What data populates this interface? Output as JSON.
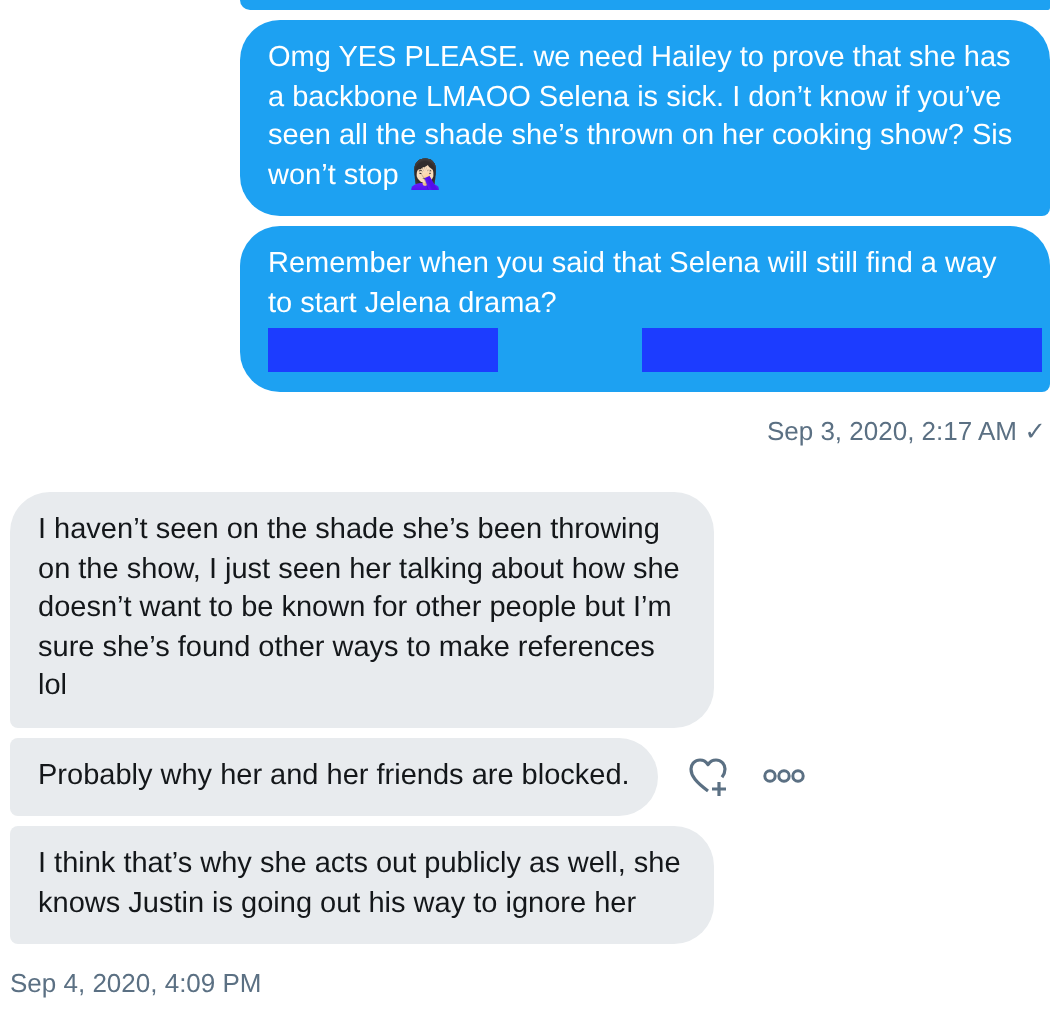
{
  "groups": [
    {
      "kind": "sent",
      "edge_above": true,
      "messages": [
        {
          "text": "Omg YES PLEASE. we need Hailey to prove that she has a backbone LMAOO Selena is sick. I don’t know if you’ve seen all the shade she’s thrown on her cooking show? Sis won’t stop 🤦🏻‍♀️",
          "redacted": false,
          "actions": false
        },
        {
          "text": "Remember when you said that Selena will still find a way to start Jelena drama?",
          "redacted": true,
          "actions": false
        }
      ],
      "timestamp": "Sep 3, 2020, 2:17 AM",
      "receipt": "✓"
    },
    {
      "kind": "received",
      "messages": [
        {
          "text": "I haven’t seen on the shade she’s been throwing on the show, I just seen her talking about how she doesn’t want to be known for other people but I’m sure she’s found other ways to make references lol",
          "redacted": false,
          "actions": false
        },
        {
          "text": "Probably why her and her friends are blocked.",
          "redacted": false,
          "actions": true
        },
        {
          "text": "I think that’s why she acts out publicly as well, she knows Justin is going out his way to ignore her",
          "redacted": false,
          "actions": false
        }
      ],
      "timestamp": "Sep 4, 2020, 4:09 PM"
    }
  ]
}
